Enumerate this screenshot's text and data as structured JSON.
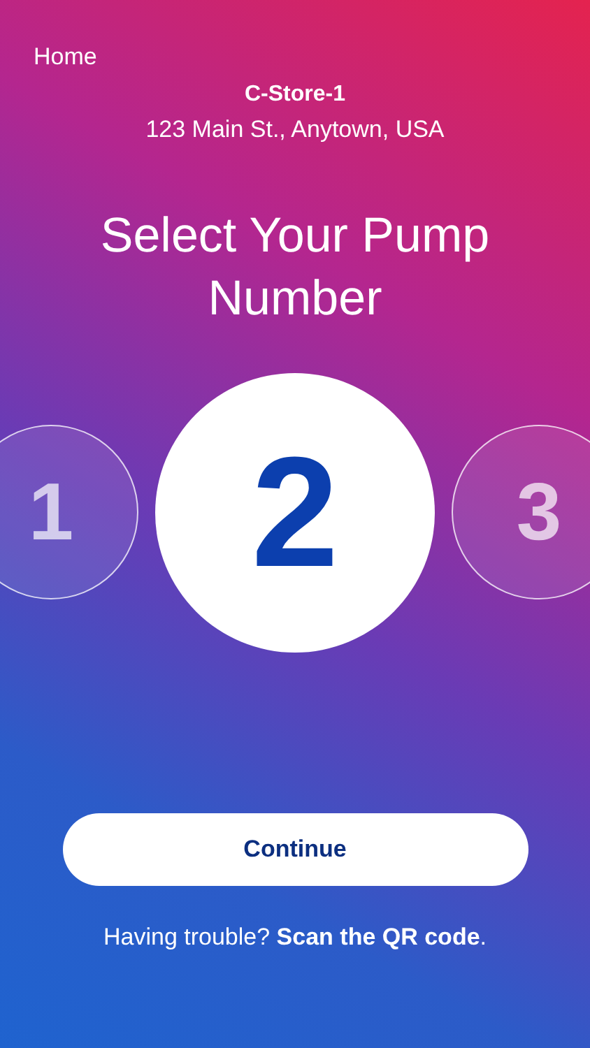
{
  "nav": {
    "home": "Home"
  },
  "store": {
    "name": "C-Store-1",
    "address": "123 Main St., Anytown, USA"
  },
  "title": "Select Your Pump Number",
  "pumps": [
    {
      "label": "1",
      "selected": false
    },
    {
      "label": "2",
      "selected": true
    },
    {
      "label": "3",
      "selected": false
    }
  ],
  "continue_button": "Continue",
  "help": "Having trouble? **Scan the QR code**."
}
